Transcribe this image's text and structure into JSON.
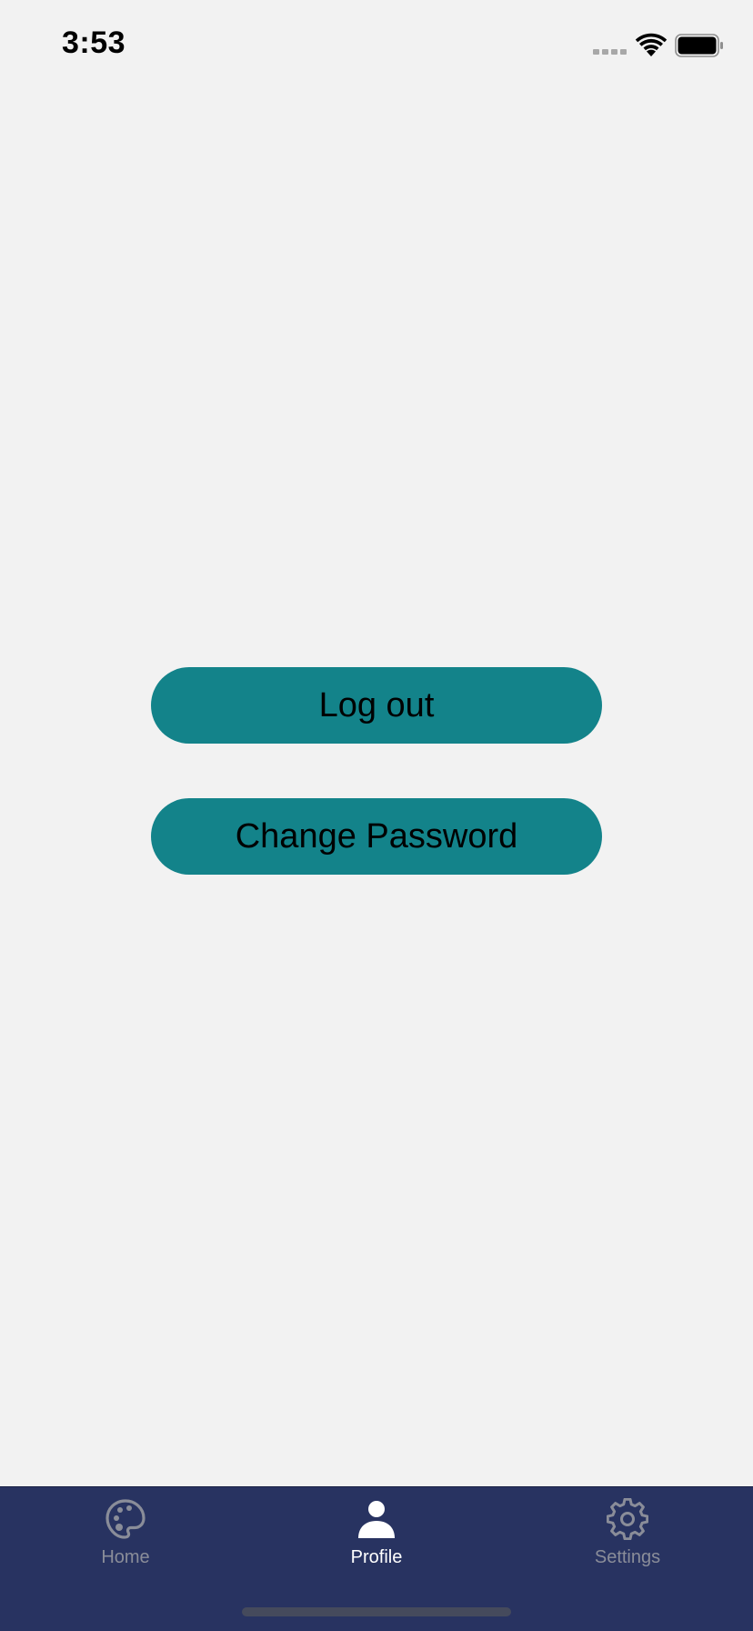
{
  "status_bar": {
    "time": "3:53"
  },
  "actions": {
    "logout_label": "Log out",
    "change_password_label": "Change Password"
  },
  "tab_bar": {
    "tabs": [
      {
        "label": "Home",
        "icon": "palette-icon",
        "active": false
      },
      {
        "label": "Profile",
        "icon": "person-icon",
        "active": true
      },
      {
        "label": "Settings",
        "icon": "gear-icon",
        "active": false
      }
    ]
  },
  "colors": {
    "background": "#f2f2f2",
    "button": "#13838a",
    "tab_bar": "#283361",
    "tab_active": "#ffffff",
    "tab_inactive": "#8a8d99"
  }
}
